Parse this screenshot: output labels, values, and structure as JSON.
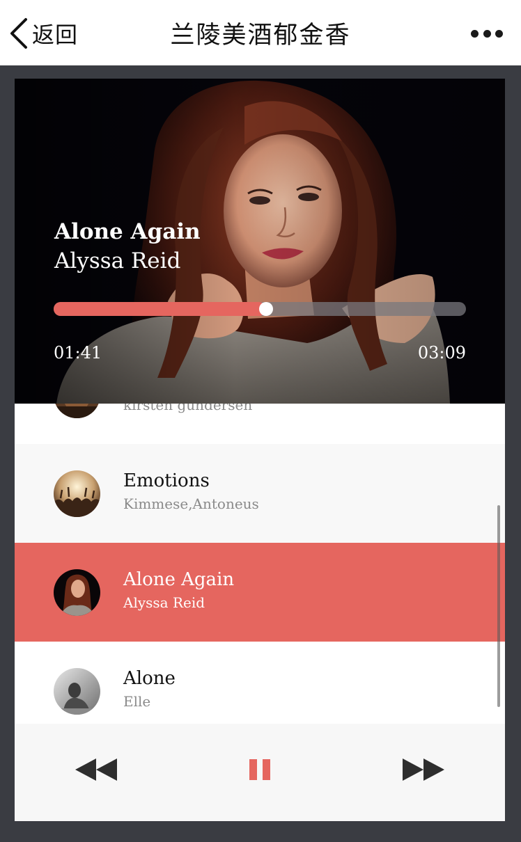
{
  "nav": {
    "back_label": "返回",
    "title": "兰陵美酒郁金香",
    "more_icon": "more-horizontal-icon"
  },
  "now_playing": {
    "title": "Alone Again",
    "artist": "Alyssa Reid",
    "current_time": "01:41",
    "total_time": "03:09",
    "progress": 0.516
  },
  "playlist": [
    {
      "title": "",
      "artist": "kirsten gundersen",
      "active": false,
      "partial": true
    },
    {
      "title": "Emotions",
      "artist": "Kimmese,Antoneus",
      "active": false
    },
    {
      "title": "Alone Again",
      "artist": "Alyssa Reid",
      "active": true
    },
    {
      "title": "Alone",
      "artist": "Elle",
      "active": false
    }
  ],
  "controls": {
    "previous_icon": "rewind-icon",
    "pause_icon": "pause-icon",
    "next_icon": "fast-forward-icon"
  },
  "colors": {
    "accent": "#e5665f",
    "background": "#3a3c42",
    "controls_bg": "#f7f7f7",
    "row_alt_bg": "#f8f8f8"
  }
}
